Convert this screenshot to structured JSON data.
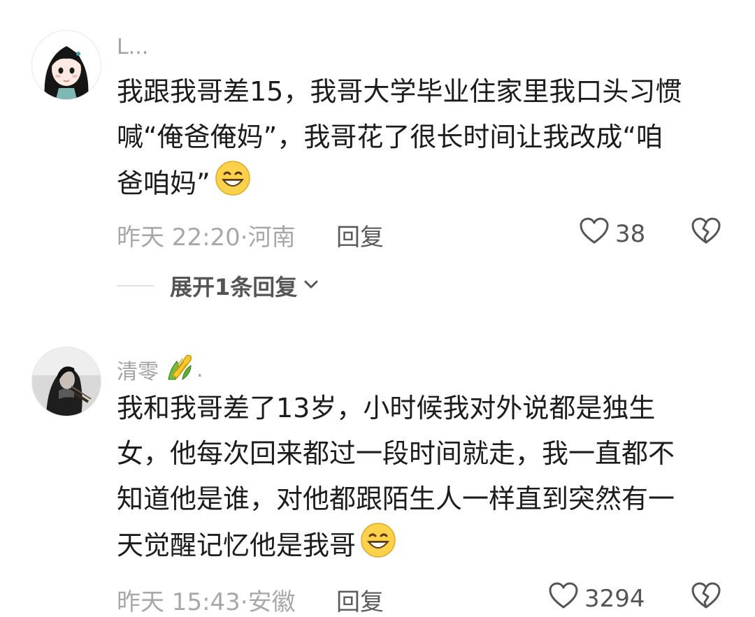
{
  "comments": [
    {
      "username": "L...",
      "lines": [
        "我跟我哥差15，我哥大学毕业住家里我口头习惯",
        "喊“俺爸俺妈”，我哥花了很长时间让我改成“咱",
        "爸咱妈”"
      ],
      "time": "昨天 22:20",
      "location": "河南",
      "reply_label": "回复",
      "likes": "38",
      "expand_label": "展开1条回复",
      "emoji": "grinning-sweat-emoji"
    },
    {
      "username": "清零",
      "username_suffix": ".",
      "username_emoji": "corn-emoji",
      "lines": [
        "我和我哥差了13岁，小时候我对外说都是独生",
        "女，他每次回来都过一段时间就走，我一直都不",
        "知道他是谁，对他都跟陌生人一样直到突然有一",
        "天觉醒记忆他是我哥"
      ],
      "time": "昨天 15:43",
      "location": "安徽",
      "reply_label": "回复",
      "likes": "3294",
      "emoji": "grinning-sweat-emoji"
    }
  ],
  "colors": {
    "text": "#1c1c1c",
    "meta": "#a8a8a8",
    "username": "#a2a2a2",
    "icon": "#555555"
  }
}
